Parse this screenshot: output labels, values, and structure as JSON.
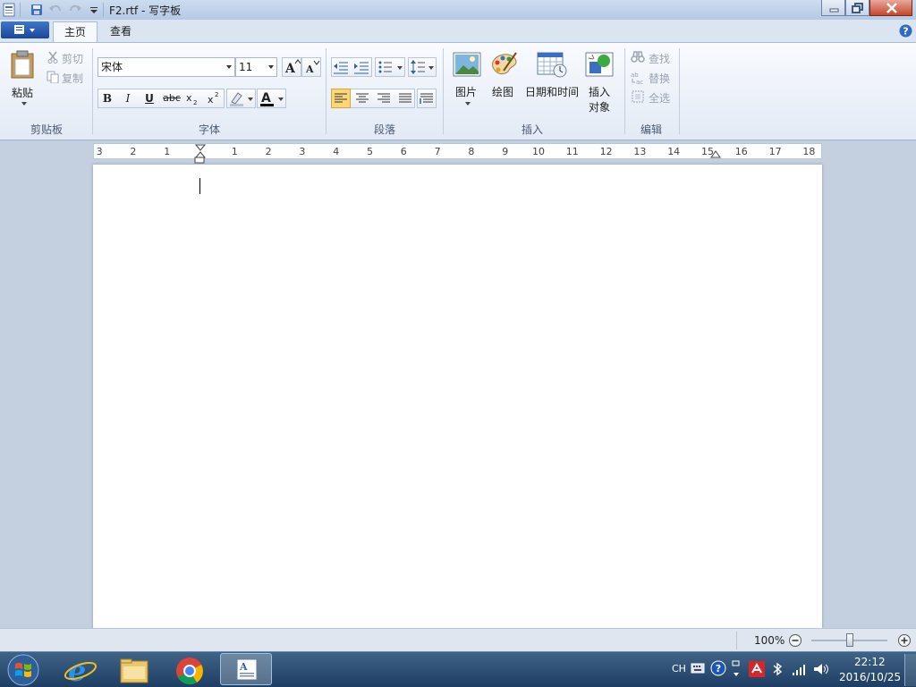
{
  "window": {
    "title": "F2.rtf - 写字板"
  },
  "tabs": [
    {
      "label": "主页"
    },
    {
      "label": "查看"
    }
  ],
  "clipboard": {
    "paste": "粘贴",
    "cut": "剪切",
    "copy": "复制",
    "group": "剪贴板"
  },
  "font": {
    "family": "宋体",
    "size": "11",
    "bold": "B",
    "italic": "I",
    "underline": "U",
    "strike": "abc",
    "group": "字体"
  },
  "paragraph": {
    "group": "段落"
  },
  "insert": {
    "picture": "图片",
    "paint": "绘图",
    "datetime": "日期和时间",
    "object_line1": "插入",
    "object_line2": "对象",
    "group": "插入"
  },
  "editing": {
    "find": "查找",
    "replace": "替换",
    "select_all": "全选",
    "group": "编辑"
  },
  "ruler": {
    "labels": [
      "3",
      "2",
      "1",
      "1",
      "2",
      "3",
      "4",
      "5",
      "6",
      "7",
      "8",
      "9",
      "10",
      "11",
      "12",
      "13",
      "14",
      "15",
      "16",
      "17",
      "18"
    ]
  },
  "status": {
    "zoom": "100%"
  },
  "tray": {
    "lang": "CH",
    "time": "22:12",
    "date": "2016/10/25"
  },
  "colors": {
    "accent": "#1f4e9c",
    "highlight_btn": "#fbd77a"
  }
}
